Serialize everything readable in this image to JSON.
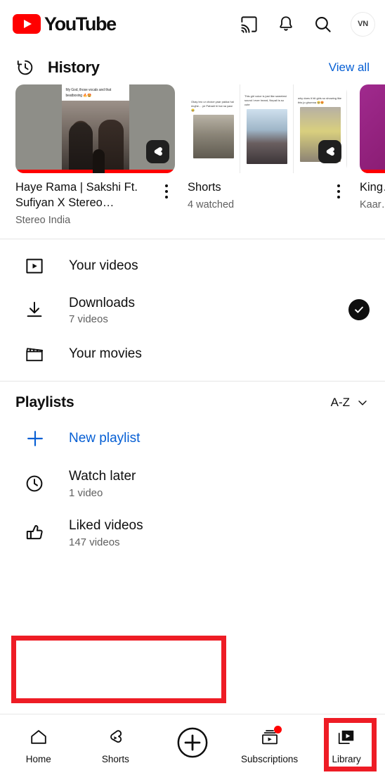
{
  "header": {
    "logo_text": "YouTube",
    "logo_color": "#ff0000",
    "actions": [
      {
        "name": "cast-icon",
        "label": "Cast"
      },
      {
        "name": "notifications-icon",
        "label": "Notifications"
      },
      {
        "name": "search-icon",
        "label": "Search"
      }
    ],
    "avatar_initials": "VN"
  },
  "history": {
    "section_title": "History",
    "view_all_label": "View all",
    "view_all_color": "#065fd4",
    "cards": [
      {
        "title": "Haye Rama | Sakshi Ft. Sufiyan X Stereo…",
        "subtitle": "Stereo India",
        "caption": "My God, those vocals and that beatboxing 🔥🤩",
        "badge": "shorts-badge",
        "progress_percent": 100,
        "menu": "more-options"
      },
      {
        "title": "Shorts",
        "subtitle": "4 watched",
        "thumbs": [
          "Okay bro ur choice yaar pakka hai mujhe… ye Pahadi hi hai na yaar 😂",
          "This girl voice is just like sweetest sound i ever heard, Nepali is so cute",
          "why does it hit girls so showing like this jo ghumna 🥹😍"
        ],
        "badge": "shorts-badge",
        "progress_percent": 0,
        "menu": "more-options"
      },
      {
        "title": "King… है un…",
        "subtitle": "Kaar…",
        "progress_percent": 100
      }
    ]
  },
  "library_items": [
    {
      "icon": "your-videos-icon",
      "title": "Your videos",
      "subtitle": "",
      "badge": ""
    },
    {
      "icon": "downloads-icon",
      "title": "Downloads",
      "subtitle": "7 videos",
      "badge": "check-circle-icon"
    },
    {
      "icon": "your-movies-icon",
      "title": "Your movies",
      "subtitle": "",
      "badge": ""
    }
  ],
  "playlists": {
    "section_title": "Playlists",
    "sort_label": "A-Z",
    "new_playlist_label": "New playlist",
    "new_playlist_color": "#065fd4",
    "items": [
      {
        "icon": "clock-icon",
        "title": "Watch later",
        "subtitle": "1 video",
        "highlighted": false
      },
      {
        "icon": "thumbs-up-icon",
        "title": "Liked videos",
        "subtitle": "147 videos",
        "highlighted": true
      }
    ]
  },
  "annotations": {
    "color": "#ee1c25",
    "boxes": [
      "liked-videos-row",
      "library-nav-item"
    ]
  },
  "bottom_nav": {
    "items": [
      {
        "name": "home",
        "label": "Home",
        "active": false,
        "badge": false
      },
      {
        "name": "shorts",
        "label": "Shorts",
        "active": false,
        "badge": false
      },
      {
        "name": "create",
        "label": "",
        "active": false,
        "badge": false
      },
      {
        "name": "subscriptions",
        "label": "Subscriptions",
        "active": false,
        "badge": true
      },
      {
        "name": "library",
        "label": "Library",
        "active": true,
        "badge": false
      }
    ]
  }
}
